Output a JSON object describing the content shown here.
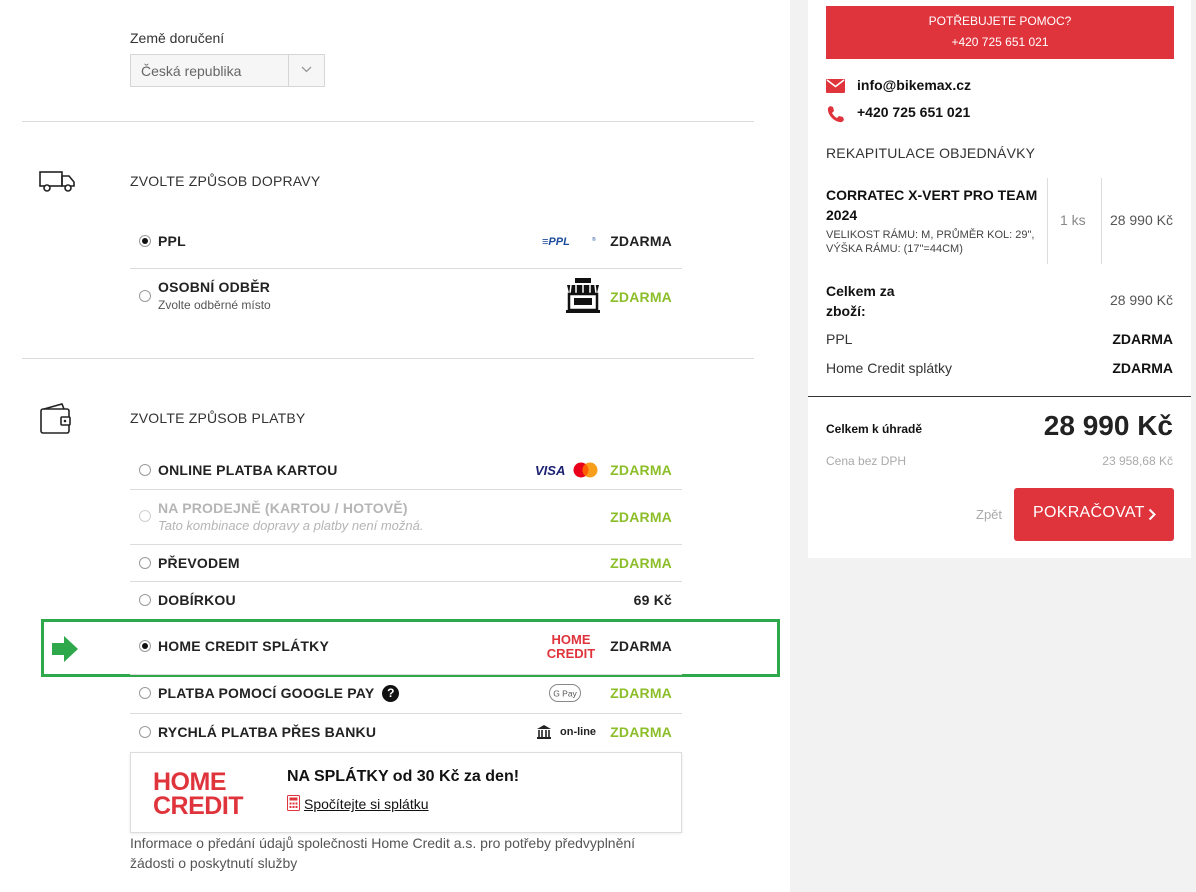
{
  "delivery": {
    "country_label": "Země doručení",
    "country_value": "Česká republika"
  },
  "shipping": {
    "title": "ZVOLTE ZPŮSOB DOPRAVY",
    "options": [
      {
        "name": "PPL",
        "sub": "",
        "price": "ZDARMA",
        "selected": true,
        "logo": "ppl-logo"
      },
      {
        "name": "OSOBNÍ ODBĚR",
        "sub": "Zvolte odběrné místo",
        "price": "ZDARMA",
        "selected": false,
        "logo": "shop-icon"
      }
    ]
  },
  "payment": {
    "title": "ZVOLTE ZPŮSOB PLATBY",
    "options": [
      {
        "name": "ONLINE PLATBA KARTOU",
        "sub": "",
        "price": "ZDARMA",
        "logo": "visa-mastercard-logo"
      },
      {
        "name": "NA PRODEJNĚ (KARTOU / HOTOVĚ)",
        "sub": "Tato kombinace dopravy a platby není možná.",
        "price": "ZDARMA",
        "disabled": true
      },
      {
        "name": "PŘEVODEM",
        "sub": "",
        "price": "ZDARMA"
      },
      {
        "name": "DOBÍRKOU",
        "sub": "",
        "price": "69 Kč"
      },
      {
        "name": "HOME CREDIT SPLÁTKY",
        "sub": "",
        "price": "ZDARMA",
        "selected": true,
        "logo": "home-credit-logo"
      },
      {
        "name": "PLATBA POMOCÍ GOOGLE PAY",
        "sub": "",
        "price": "ZDARMA",
        "logo": "google-pay-logo",
        "help": "?"
      },
      {
        "name": "RYCHLÁ PLATBA PŘES BANKU",
        "sub": "",
        "price": "ZDARMA",
        "logo": "bank-icon",
        "logo_text": "on-line"
      }
    ]
  },
  "home_credit": {
    "logo_line1": "HOME",
    "logo_line2": "CREDIT",
    "headline": "NA SPLÁTKY od 30 Kč za den!",
    "link": "Spočítejte si splátku",
    "info": "Informace o předání údajů společnosti Home Credit a.s. pro potřeby předvyplnění žádosti o poskytnutí služby"
  },
  "sidebar": {
    "help_title": "POTŘEBUJETE POMOC?",
    "help_phone": "+420 725 651 021",
    "email": "info@bikemax.cz",
    "phone": "+420 725 651 021",
    "recap_title": "REKAPITULACE OBJEDNÁVKY",
    "product": {
      "name": "CORRATEC X-VERT PRO TEAM 2024",
      "attrs": "VELIKOST RÁMU: M, PRŮMĚR KOL: 29\", VÝŠKA RÁMU: (17\"=44CM)",
      "qty": "1 ks",
      "price": "28 990 Kč"
    },
    "goods_total_label": "Celkem za zboží:",
    "goods_total_value": "28 990 Kč",
    "shipping_label": "PPL",
    "shipping_value": "ZDARMA",
    "payment_label": "Home Credit splátky",
    "payment_value": "ZDARMA",
    "total_label": "Celkem k úhradě",
    "total_value": "28 990 Kč",
    "nodph_label": "Cena bez DPH",
    "nodph_value": "23 958,68 Kč",
    "back_label": "Zpět",
    "continue_label": "POKRAČOVAT"
  },
  "colors": {
    "brand_red": "#e0343d",
    "free_green": "#8cbe2a",
    "highlight_green": "#2ea84a"
  }
}
